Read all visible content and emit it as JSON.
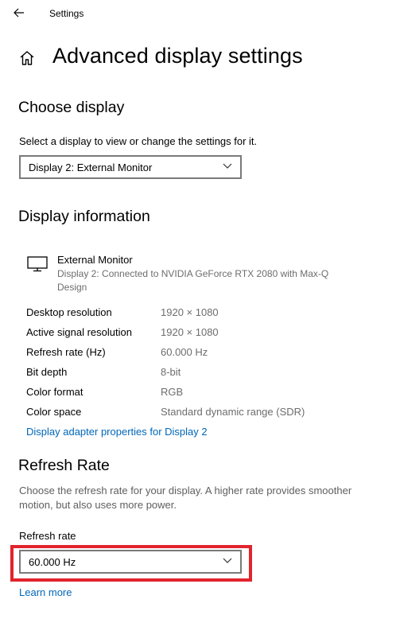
{
  "window": {
    "title": "Settings"
  },
  "page": {
    "title": "Advanced display settings"
  },
  "choose_display": {
    "heading": "Choose display",
    "description": "Select a display to view or change the settings for it.",
    "selected": "Display 2: External Monitor"
  },
  "display_info": {
    "heading": "Display information",
    "monitor_name": "External Monitor",
    "monitor_desc": "Display 2: Connected to NVIDIA GeForce RTX 2080 with Max-Q Design",
    "rows": [
      {
        "label": "Desktop resolution",
        "value": "1920 × 1080"
      },
      {
        "label": "Active signal resolution",
        "value": "1920 × 1080"
      },
      {
        "label": "Refresh rate (Hz)",
        "value": "60.000 Hz"
      },
      {
        "label": "Bit depth",
        "value": "8-bit"
      },
      {
        "label": "Color format",
        "value": "RGB"
      },
      {
        "label": "Color space",
        "value": "Standard dynamic range (SDR)"
      }
    ],
    "adapter_link": "Display adapter properties for Display 2"
  },
  "refresh": {
    "heading": "Refresh Rate",
    "description": "Choose the refresh rate for your display. A higher rate provides smoother motion, but also uses more power.",
    "label": "Refresh rate",
    "selected": "60.000 Hz",
    "learn_more": "Learn more"
  },
  "colors": {
    "link": "#0067b8",
    "highlight": "#e1242d"
  }
}
